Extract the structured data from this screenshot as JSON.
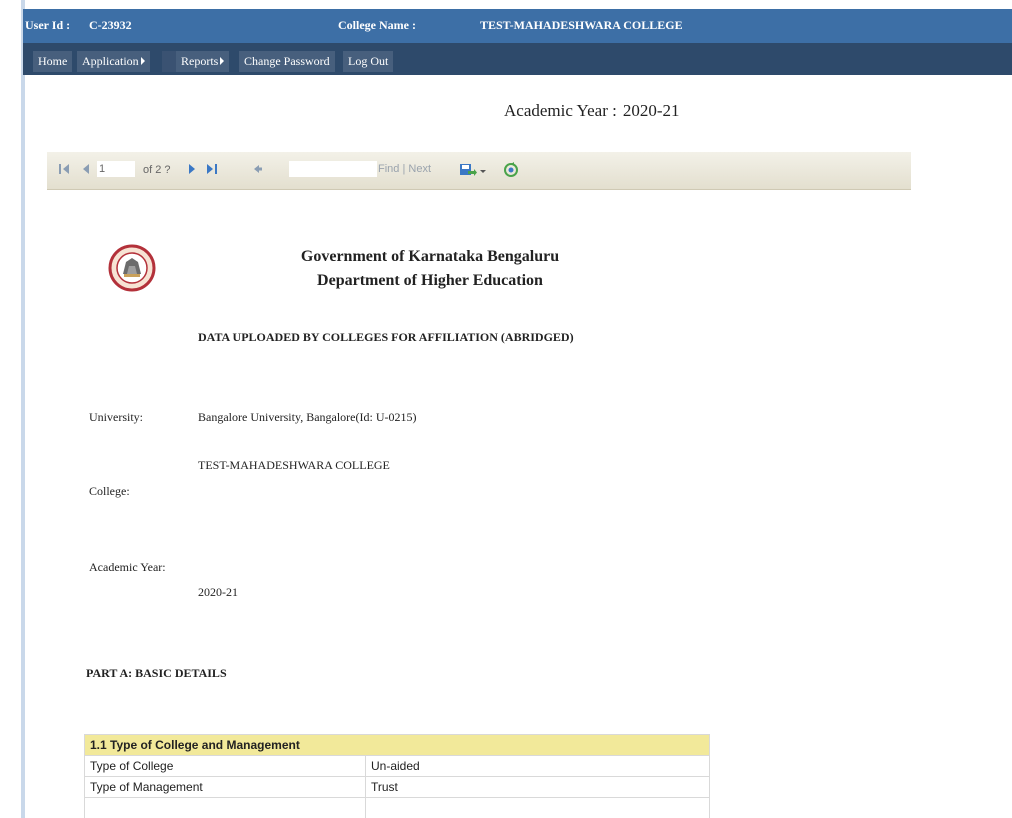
{
  "header": {
    "user_id_label": "User Id :",
    "user_id_value": "C-23932",
    "college_name_label": "College Name :",
    "college_name_value": "TEST-MAHADESHWARA COLLEGE"
  },
  "nav": {
    "items": [
      {
        "label": "Home"
      },
      {
        "label": "Application"
      },
      {
        "label": "Reports"
      },
      {
        "label": "Change Password"
      },
      {
        "label": "Log Out"
      }
    ]
  },
  "banner": {
    "academic_year_label": "Academic Year :",
    "academic_year_value": "2020-21"
  },
  "toolbar": {
    "page_current": "1",
    "page_of": "of 2 ?",
    "find_label": "Find",
    "separator": "|",
    "next_label": "Next"
  },
  "document": {
    "title_line1": "Government of Karnataka Bengaluru",
    "title_line2": "Department of Higher Education",
    "subtitle": "DATA UPLOADED BY COLLEGES FOR AFFILIATION (ABRIDGED)",
    "university_label": "University:",
    "university_value": "Bangalore University, Bangalore(Id: U-0215)",
    "college_label": "College:",
    "college_value": "TEST-MAHADESHWARA COLLEGE",
    "academic_year_label": "Academic Year:",
    "academic_year_value": "2020-21",
    "part_a": "PART A: BASIC DETAILS"
  },
  "table": {
    "header": "1.1 Type of College and Management",
    "rows": [
      {
        "key": "Type of College",
        "value": "Un-aided"
      },
      {
        "key": "Type of Management",
        "value": "Trust"
      },
      {
        "key": "",
        "value": ""
      }
    ]
  },
  "colors": {
    "header_bg": "#3d6fa6",
    "nav_bg": "#2e4a6b",
    "table_header_bg": "#f2e99a"
  }
}
